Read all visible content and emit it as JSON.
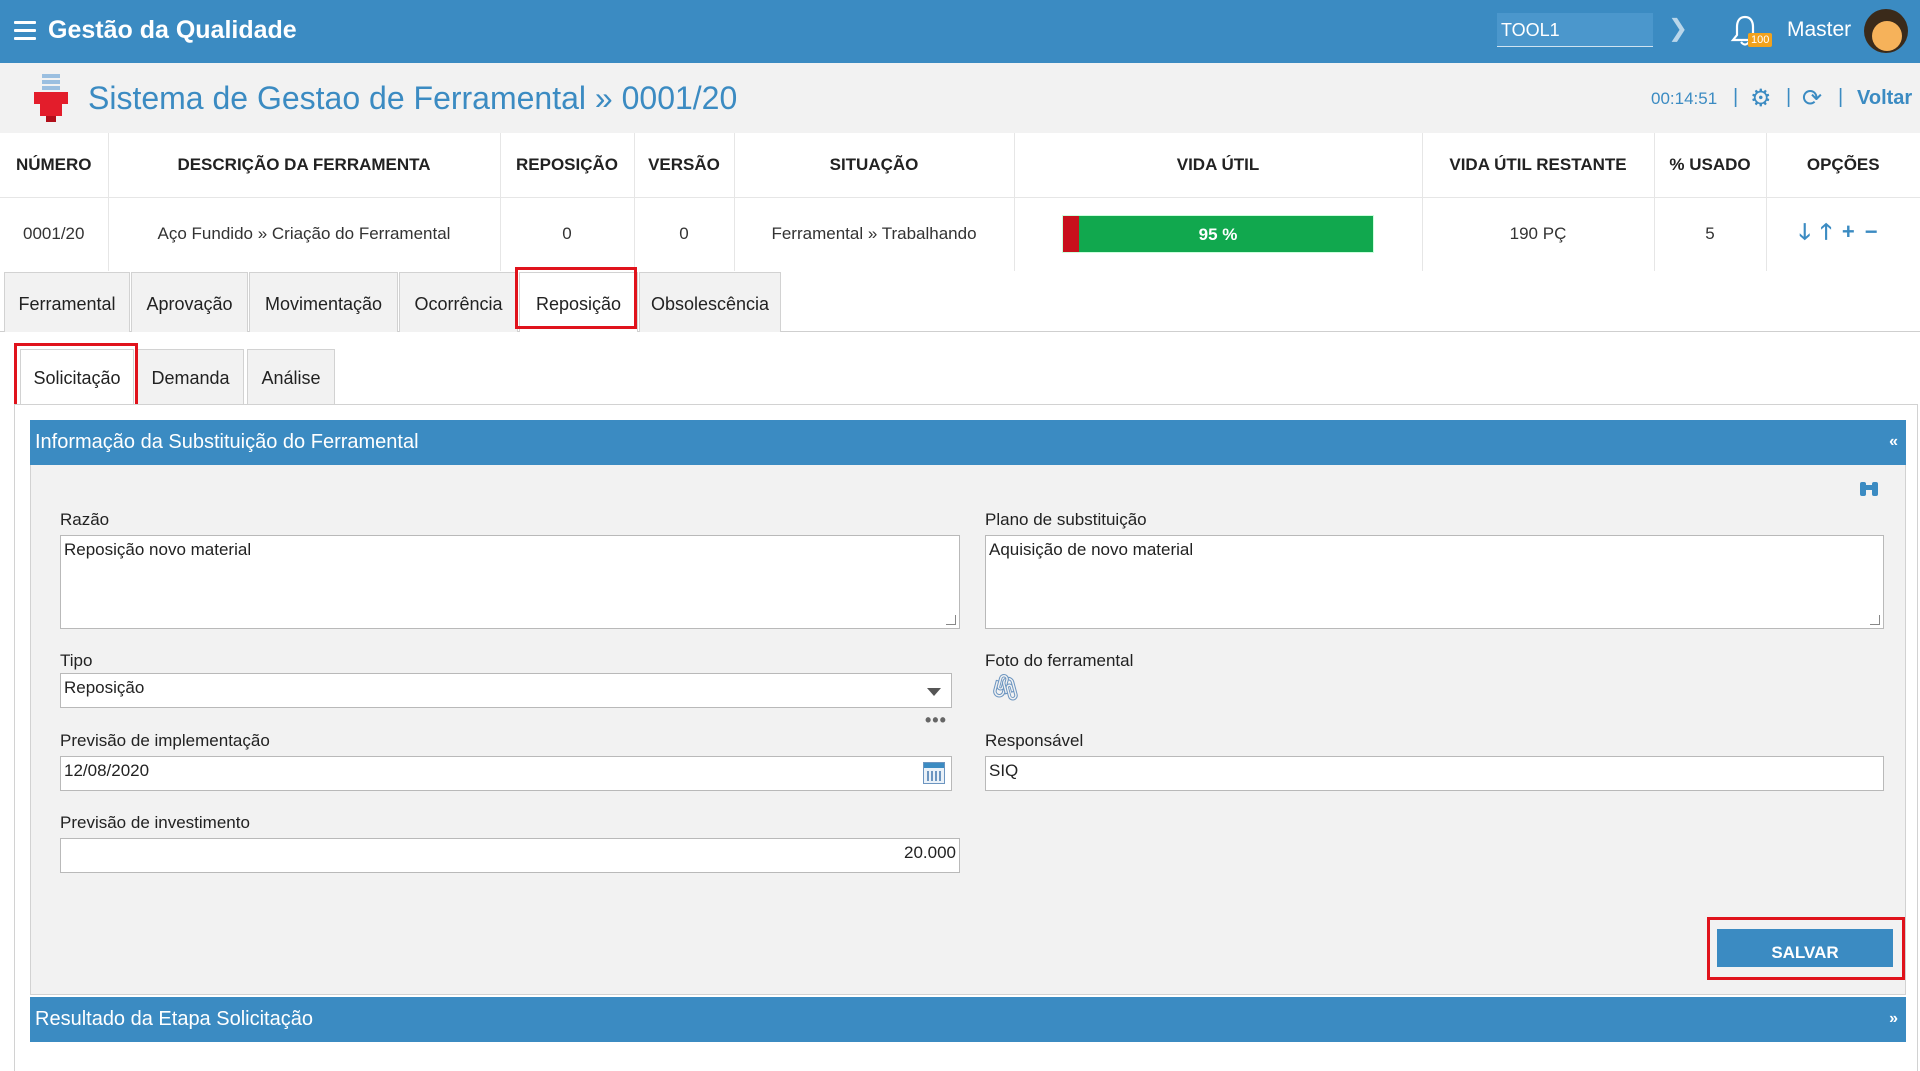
{
  "app": {
    "title": "Gestão da Qualidade",
    "tool_field": "TOOL1",
    "notification_count": "100",
    "user_name": "Master"
  },
  "page": {
    "title": "Sistema de Gestao de Ferramental » 0001/20",
    "timer": "00:14:51",
    "back_label": "Voltar"
  },
  "summary": {
    "headers": {
      "numero": "NÚMERO",
      "descricao": "DESCRIÇÃO DA FERRAMENTA",
      "reposicao": "REPOSIÇÃO",
      "versao": "VERSÃO",
      "situacao": "SITUAÇÃO",
      "vida_util": "VIDA ÚTIL",
      "vida_restante": "VIDA ÚTIL RESTANTE",
      "usado": "% USADO",
      "opcoes": "OPÇÕES"
    },
    "row": {
      "numero": "0001/20",
      "descricao": "Aço Fundido » Criação do Ferramental",
      "reposicao": "0",
      "versao": "0",
      "situacao": "Ferramental » Trabalhando",
      "vida_util_label": "95 %",
      "vida_util_percent": 95,
      "vida_restante": "190 PÇ",
      "usado": "5"
    },
    "bar_colors": {
      "ok": "#11a84e",
      "used": "#c8101c"
    }
  },
  "tabs": {
    "main": [
      "Ferramental",
      "Aprovação",
      "Movimentação",
      "Ocorrência",
      "Reposição",
      "Obsolescência"
    ],
    "active_main": "Reposição",
    "sub": [
      "Solicitação",
      "Demanda",
      "Análise"
    ],
    "active_sub": "Solicitação"
  },
  "panel": {
    "title": "Informação da Substituição do Ferramental",
    "collapse_glyph": "«",
    "fields": {
      "razao_label": "Razão",
      "razao_value": "Reposição novo material",
      "plano_label": "Plano de substituição",
      "plano_value": "Aquisição de novo material",
      "tipo_label": "Tipo",
      "tipo_value": "Reposição",
      "foto_label": "Foto do ferramental",
      "previsao_impl_label": "Previsão de implementação",
      "previsao_impl_value": "12/08/2020",
      "responsavel_label": "Responsável",
      "responsavel_value": "SIQ",
      "previsao_inv_label": "Previsão de investimento",
      "previsao_inv_value": "20.000"
    },
    "save_label": "SALVAR"
  },
  "panel2": {
    "title": "Resultado da Etapa Solicitação",
    "expand_glyph": "»"
  },
  "colors": {
    "brand": "#3b8bc2",
    "highlight": "#e0131c"
  }
}
